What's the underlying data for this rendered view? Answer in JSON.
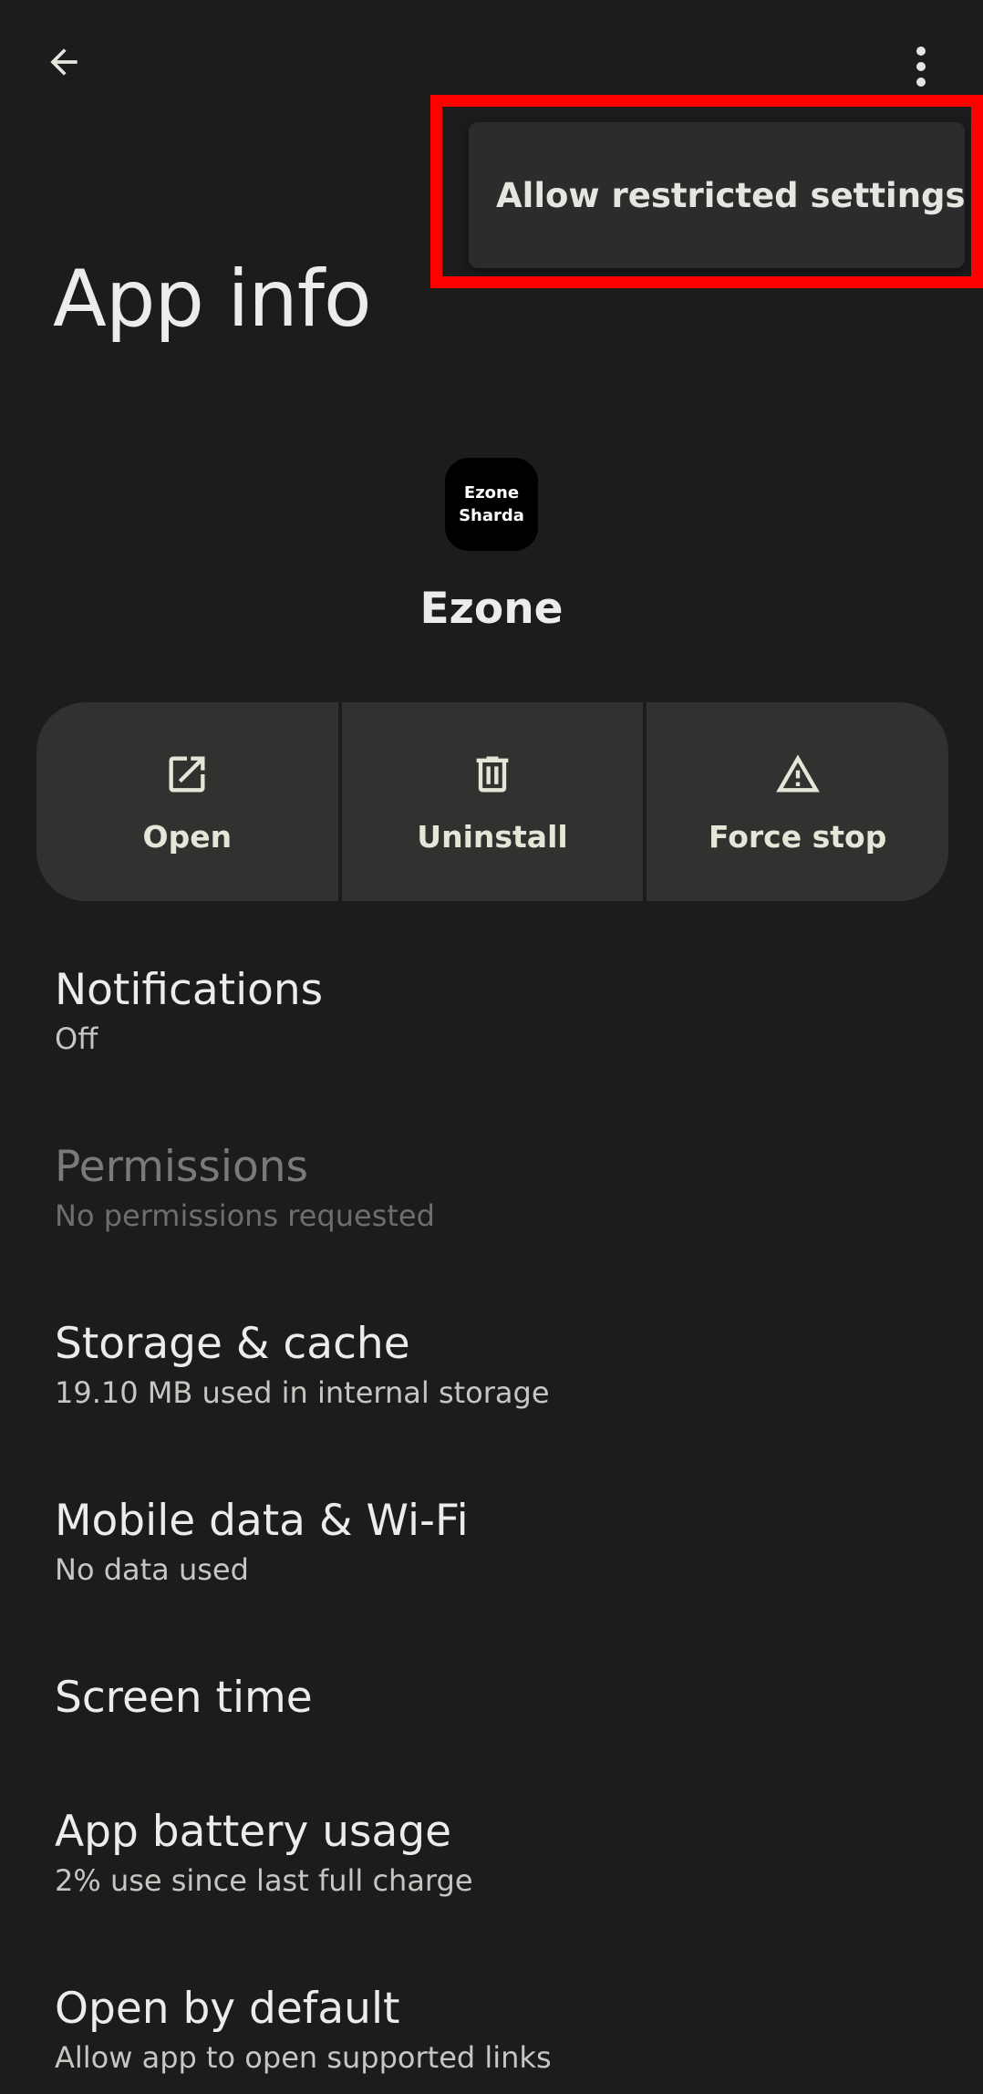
{
  "header": {
    "back_icon": "arrow-left-icon",
    "more_icon": "more-vert-icon",
    "title": "App info"
  },
  "overflow_menu": {
    "items": [
      {
        "label": "Allow restricted settings",
        "highlighted": true
      }
    ],
    "highlight_color": "#ff0000"
  },
  "app": {
    "icon_text_line1": "Ezone",
    "icon_text_line2": "Sharda",
    "name": "Ezone"
  },
  "actions": [
    {
      "label": "Open",
      "icon": "open-external-icon"
    },
    {
      "label": "Uninstall",
      "icon": "trash-icon"
    },
    {
      "label": "Force stop",
      "icon": "warning-icon"
    }
  ],
  "settings": [
    {
      "title": "Notifications",
      "summary": "Off",
      "enabled": true
    },
    {
      "title": "Permissions",
      "summary": "No permissions requested",
      "enabled": false
    },
    {
      "title": "Storage & cache",
      "summary": "19.10 MB used in internal storage",
      "enabled": true
    },
    {
      "title": "Mobile data & Wi-Fi",
      "summary": "No data used",
      "enabled": true
    },
    {
      "title": "Screen time",
      "summary": "",
      "enabled": true
    },
    {
      "title": "App battery usage",
      "summary": "2% use since last full charge",
      "enabled": true
    },
    {
      "title": "Open by default",
      "summary": "Allow app to open supported links",
      "enabled": true
    }
  ],
  "colors": {
    "background": "#1c1c1c",
    "surface": "#313130",
    "menu_surface": "#2c2c2c",
    "text_primary": "#ececea",
    "text_secondary": "#c6c6c2",
    "text_disabled": "#7a7a78"
  }
}
